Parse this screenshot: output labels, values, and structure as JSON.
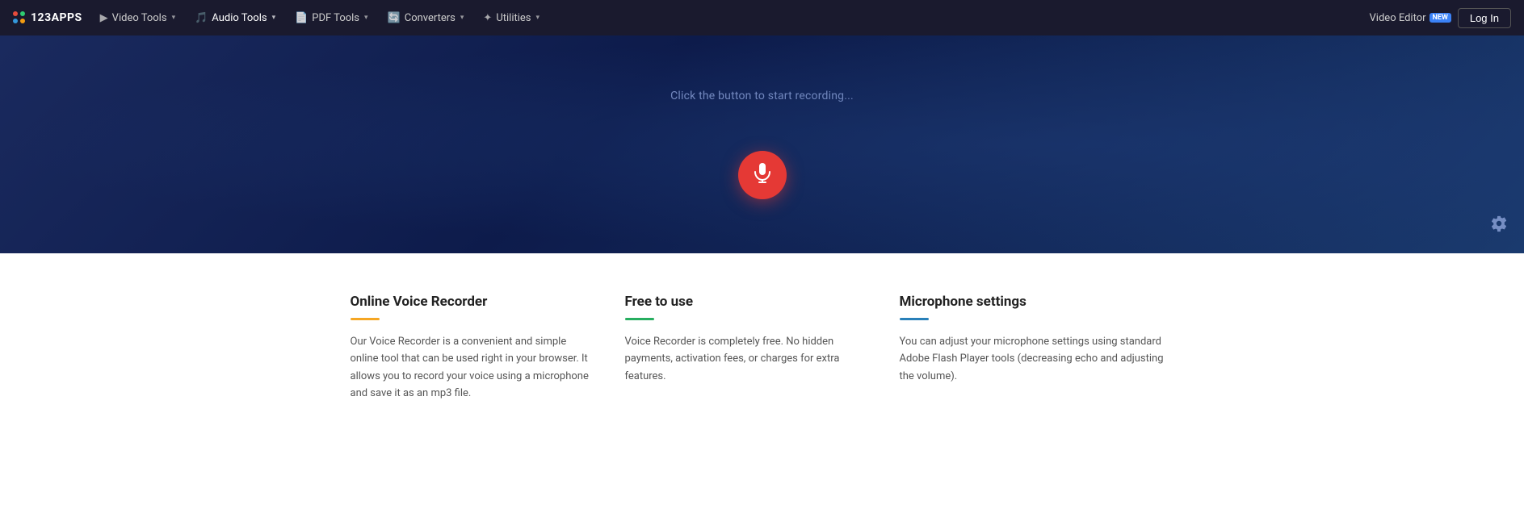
{
  "logo": {
    "text": "123APPS"
  },
  "navbar": {
    "items": [
      {
        "id": "video-tools",
        "icon": "▶",
        "label": "Video Tools",
        "hasChevron": true
      },
      {
        "id": "audio-tools",
        "icon": "🎵",
        "label": "Audio Tools",
        "hasChevron": true
      },
      {
        "id": "pdf-tools",
        "icon": "📄",
        "label": "PDF Tools",
        "hasChevron": true
      },
      {
        "id": "converters",
        "icon": "🔄",
        "label": "Converters",
        "hasChevron": true
      },
      {
        "id": "utilities",
        "icon": "✦",
        "label": "Utilities",
        "hasChevron": true
      }
    ],
    "video_editor_label": "Video Editor",
    "new_badge": "NEW",
    "login_label": "Log In"
  },
  "hero": {
    "prompt": "Click the button to start recording...",
    "record_button_label": "Record",
    "settings_label": "Settings"
  },
  "info": {
    "cards": [
      {
        "id": "online-voice-recorder",
        "title": "Online Voice Recorder",
        "divider_class": "divider-yellow",
        "text": "Our Voice Recorder is a convenient and simple online tool that can be used right in your browser. It allows you to record your voice using a microphone and save it as an mp3 file."
      },
      {
        "id": "free-to-use",
        "title": "Free to use",
        "divider_class": "divider-green",
        "text": "Voice Recorder is completely free. No hidden payments, activation fees, or charges for extra features."
      },
      {
        "id": "microphone-settings",
        "title": "Microphone settings",
        "divider_class": "divider-blue",
        "text": "You can adjust your microphone settings using standard Adobe Flash Player tools (decreasing echo and adjusting the volume)."
      }
    ]
  }
}
